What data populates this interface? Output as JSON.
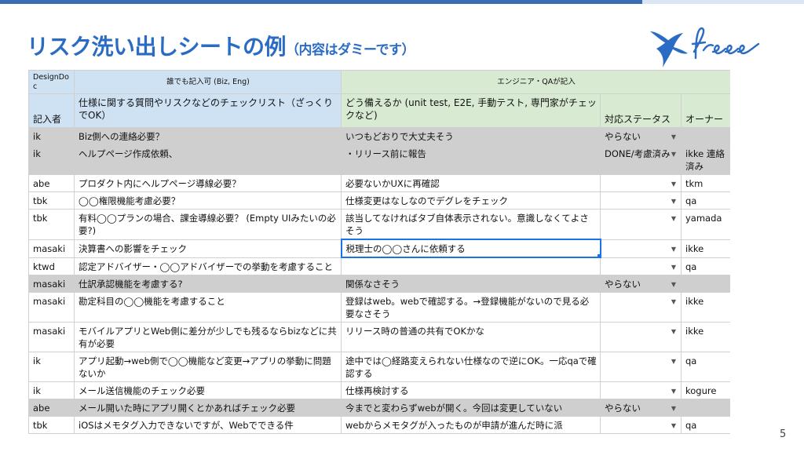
{
  "slide": {
    "title": "リスク洗い出しシートの例",
    "subtitle": "（内容はダミーです）",
    "page_number": "5",
    "logo_text": "freee"
  },
  "sheet": {
    "group_headers": {
      "col_a": "DesignDoc",
      "col_b": "誰でも記入可 (Biz, Eng)",
      "col_c": "エンジニア・QAが記入"
    },
    "headers": {
      "author": "記入者",
      "checklist": "仕様に関する質問やリスクなどのチェックリスト（ざっくりでOK）",
      "response": "どう備えるか (unit test, E2E, 手動テスト, 専門家がチェックなど)",
      "status": "対応ステータス",
      "owner": "オーナー"
    },
    "rows": [
      {
        "author": "ik",
        "item": "Biz側への連絡必要？",
        "response": "いつもどおりで大丈夫そう",
        "status": "やらない",
        "owner": ""
      },
      {
        "author": "ik",
        "item": "ヘルプページ作成依頼、",
        "response": "・リリース前に報告",
        "status": "DONE/考慮済み",
        "owner": "ikke 連絡済み"
      },
      {
        "author": "abe",
        "item": "プロダクト内にヘルプページ導線必要？",
        "response": "必要ないかUXに再確認",
        "status": "",
        "owner": "tkm"
      },
      {
        "author": "tbk",
        "item": "◯◯権限機能考慮必要？",
        "response": "仕様変更はなしなのでデグレをチェック",
        "status": "",
        "owner": "qa"
      },
      {
        "author": "tbk",
        "item": "有料◯◯プランの場合、課金導線必要？ (Empty UIみたいの必要?)",
        "response": "該当してなければタブ自体表示されない。意識しなくてよさそう",
        "status": "",
        "owner": "yamada"
      },
      {
        "author": "masaki",
        "item": "決算書への影響をチェック",
        "response": "税理士の◯◯さんに依頼する",
        "status": "",
        "owner": "ikke"
      },
      {
        "author": "ktwd",
        "item": "認定アドバイザー・◯◯アドバイザーでの挙動を考慮すること",
        "response": "",
        "status": "",
        "owner": "qa"
      },
      {
        "author": "masaki",
        "item": "仕訳承認機能を考慮する?",
        "response": "関係なさそう",
        "status": "やらない",
        "owner": ""
      },
      {
        "author": "masaki",
        "item": "勘定科目の◯◯機能を考慮すること",
        "response": "登録はweb。webで確認する。→登録機能がないので見る必要なさそう",
        "status": "",
        "owner": "ikke"
      },
      {
        "author": "masaki",
        "item": "モバイルアプリとWeb側に差分が少しでも残るならbizなどに共有が必要",
        "response": "リリース時の普通の共有でOKかな",
        "status": "",
        "owner": "ikke"
      },
      {
        "author": "ik",
        "item": "アプリ起動→web側で◯◯機能など変更→アプリの挙動に問題ないか",
        "response": "途中では◯経路変えられない仕様なので逆にOK。一応qaで確認する",
        "status": "",
        "owner": "qa"
      },
      {
        "author": "ik",
        "item": "メール送信機能のチェック必要",
        "response": "仕様再検討する",
        "status": "",
        "owner": "kogure"
      },
      {
        "author": "abe",
        "item": "メール開いた時にアプリ開くとかあればチェック必要",
        "response": "今までと変わらずwebが開く。今回は変更していない",
        "status": "やらない",
        "owner": ""
      },
      {
        "author": "tbk",
        "item": "iOSはメモタグ入力できないですが、Webでできる件",
        "response": "webからメモタグが入ったものが申請が進んだ時に派",
        "status": "",
        "owner": "qa"
      }
    ]
  }
}
